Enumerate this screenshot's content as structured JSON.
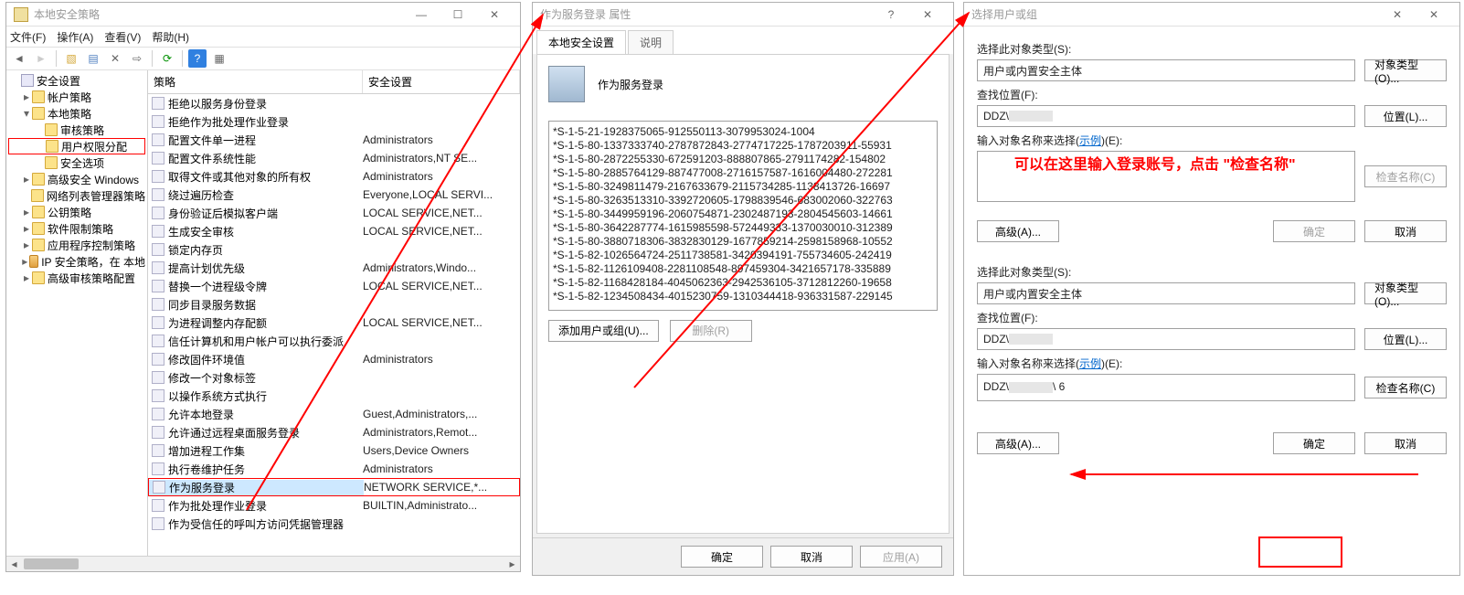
{
  "win1": {
    "title": "本地安全策略",
    "menu": {
      "file": "文件(F)",
      "action": "操作(A)",
      "view": "查看(V)",
      "help": "帮助(H)"
    },
    "tree": [
      {
        "lvl": 0,
        "tw": "",
        "icn": "root",
        "label": "安全设置"
      },
      {
        "lvl": 1,
        "tw": "▸",
        "icn": "folder",
        "label": "帐户策略"
      },
      {
        "lvl": 1,
        "tw": "▾",
        "icn": "folder",
        "label": "本地策略"
      },
      {
        "lvl": 2,
        "tw": "",
        "icn": "folder",
        "label": "审核策略"
      },
      {
        "lvl": 2,
        "tw": "",
        "icn": "folder",
        "label": "用户权限分配",
        "sel": true
      },
      {
        "lvl": 2,
        "tw": "",
        "icn": "folder",
        "label": "安全选项"
      },
      {
        "lvl": 1,
        "tw": "▸",
        "icn": "folder",
        "label": "高级安全 Windows"
      },
      {
        "lvl": 1,
        "tw": "",
        "icn": "folder",
        "label": "网络列表管理器策略"
      },
      {
        "lvl": 1,
        "tw": "▸",
        "icn": "folder",
        "label": "公钥策略"
      },
      {
        "lvl": 1,
        "tw": "▸",
        "icn": "folder",
        "label": "软件限制策略"
      },
      {
        "lvl": 1,
        "tw": "▸",
        "icn": "folder",
        "label": "应用程序控制策略"
      },
      {
        "lvl": 1,
        "tw": "▸",
        "icn": "key",
        "label": "IP 安全策略，在 本地"
      },
      {
        "lvl": 1,
        "tw": "▸",
        "icn": "folder",
        "label": "高级审核策略配置"
      }
    ],
    "columns": {
      "c1": "策略",
      "c2": "安全设置"
    },
    "rows": [
      {
        "p": "拒绝以服务身份登录",
        "s": ""
      },
      {
        "p": "拒绝作为批处理作业登录",
        "s": ""
      },
      {
        "p": "配置文件单一进程",
        "s": "Administrators"
      },
      {
        "p": "配置文件系统性能",
        "s": "Administrators,NT SE..."
      },
      {
        "p": "取得文件或其他对象的所有权",
        "s": "Administrators"
      },
      {
        "p": "绕过遍历检查",
        "s": "Everyone,LOCAL SERVI..."
      },
      {
        "p": "身份验证后模拟客户端",
        "s": "LOCAL SERVICE,NET..."
      },
      {
        "p": "生成安全审核",
        "s": "LOCAL SERVICE,NET..."
      },
      {
        "p": "锁定内存页",
        "s": ""
      },
      {
        "p": "提高计划优先级",
        "s": "Administrators,Windo..."
      },
      {
        "p": "替换一个进程级令牌",
        "s": "LOCAL SERVICE,NET..."
      },
      {
        "p": "同步目录服务数据",
        "s": ""
      },
      {
        "p": "为进程调整内存配额",
        "s": "LOCAL SERVICE,NET..."
      },
      {
        "p": "信任计算机和用户帐户可以执行委派",
        "s": ""
      },
      {
        "p": "修改固件环境值",
        "s": "Administrators"
      },
      {
        "p": "修改一个对象标签",
        "s": ""
      },
      {
        "p": "以操作系统方式执行",
        "s": ""
      },
      {
        "p": "允许本地登录",
        "s": "Guest,Administrators,..."
      },
      {
        "p": "允许通过远程桌面服务登录",
        "s": "Administrators,Remot..."
      },
      {
        "p": "增加进程工作集",
        "s": "Users,Device Owners"
      },
      {
        "p": "执行卷维护任务",
        "s": "Administrators"
      },
      {
        "p": "作为服务登录",
        "s": "NETWORK SERVICE,*...",
        "sel": true
      },
      {
        "p": "作为批处理作业登录",
        "s": "BUILTIN,Administrato..."
      },
      {
        "p": "作为受信任的呼叫方访问凭据管理器",
        "s": ""
      }
    ]
  },
  "dlg": {
    "title": "作为服务登录 属性",
    "tab1": "本地安全设置",
    "tab2": "说明",
    "heading": "作为服务登录",
    "sids": "*S-1-5-21-1928375065-912550113-3079953024-1004\n*S-1-5-80-1337333740-2787872843-2774717225-1787203911-55931\n*S-1-5-80-2872255330-672591203-888807865-2791174282-154802\n*S-1-5-80-2885764129-887477008-2716157587-1616004480-272281\n*S-1-5-80-3249811479-2167633679-211573428​5-1138413726-16697\n*S-1-5-80-3263513310-3392720605-179883​9546-683002060-322763\n*S-1-5-80-3449959196-2060754871-2302487193-2804545603-14661\n*S-1-5-80-3642287774-1615985598-572449333-1370030010-312389\n*S-1-5-80-3880718306-3832830129-1677859214-2598158968-10552\n*S-1-5-82-1026564724-2511738581-34203​94191-755734605-242419\n*S-1-5-82-1126109408-2281108548-897459304-3421657178-335889\n*S-1-5-82-1168428184-4045062363-2942536105-3712812260-19658\n*S-1-5-82-1234508434-4015230759-1310344418-936331587-229145",
    "addBtn": "添加用户或组(U)...",
    "removeBtn": "删除(R)",
    "ok": "确定",
    "cancel": "取消",
    "apply": "应用(A)"
  },
  "usr": {
    "title": "选择用户或组",
    "lbl_type": "选择此对象类型(S):",
    "typeVal": "用户或内置安全主体",
    "btn_type": "对象类型(O)...",
    "lbl_loc": "查找位置(F):",
    "locVal": "DDZ\\",
    "btn_loc": "位置(L)...",
    "lbl_name_pre": "输入对象名称来选择(",
    "lbl_name_link": "示例",
    "lbl_name_post": ")(E):",
    "btn_check": "检查名称(C)",
    "btn_adv": "高级(A)...",
    "ok": "确定",
    "cancel": "取消",
    "nameVal2": "DDZ\\        \\ 6",
    "annotation": "可以在这里输入登录账号，点击\n\"检查名称\""
  }
}
